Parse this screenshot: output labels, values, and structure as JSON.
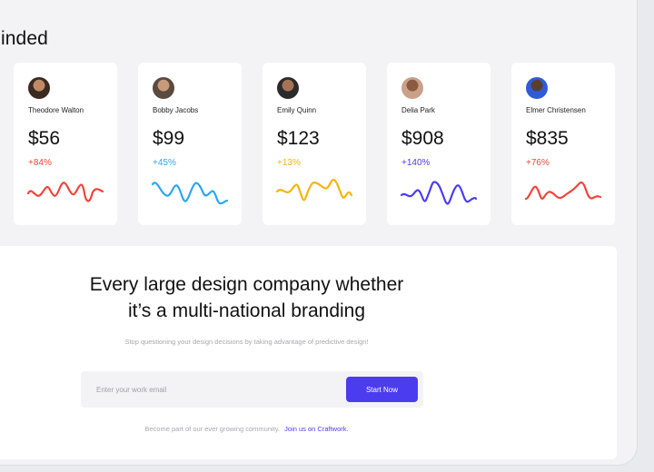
{
  "header": {
    "section_title": "inded",
    "add_label": "+"
  },
  "cards": [
    {
      "name": "Theodore Walton",
      "price": "$56",
      "change": "+84%",
      "color": "#f0443a"
    },
    {
      "name": "Bobby Jacobs",
      "price": "$99",
      "change": "+45%",
      "color": "#2aa6ef"
    },
    {
      "name": "Emily Quinn",
      "price": "$123",
      "change": "+13%",
      "color": "#f5b40f"
    },
    {
      "name": "Delia Park",
      "price": "$908",
      "change": "+140%",
      "color": "#4c3cf0"
    },
    {
      "name": "Elmer Christensen",
      "price": "$835",
      "change": "+76%",
      "color": "#f0443a"
    }
  ],
  "cta": {
    "heading_line1": "Every large design company whether",
    "heading_line2": "it’s a multi-national branding",
    "subtext": "Stop questioning your design decisions by taking advantage of predictive design!",
    "email_placeholder": "Enter your work email",
    "button_label": "Start Now",
    "community_text": "Become part of our ever growing community.",
    "community_link": "Join us on Craftwork."
  },
  "colors": {
    "accent": "#4c3cf0",
    "positive_green": "#2ecc71"
  }
}
